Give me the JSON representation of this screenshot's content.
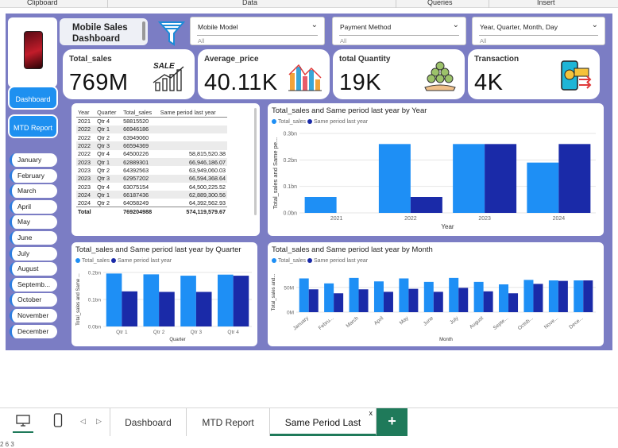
{
  "ribbon": {
    "clipboard": "Clipboard",
    "data": "Data",
    "queries": "Queries",
    "insert": "Insert"
  },
  "title": "Mobile Sales Dashboard",
  "slicers": [
    {
      "label": "Mobile Model",
      "value": "All"
    },
    {
      "label": "Payment Method",
      "value": "All"
    },
    {
      "label": "Year, Quarter, Month, Day",
      "value": "All"
    }
  ],
  "kpis": [
    {
      "title": "Total_sales",
      "value": "769M",
      "icon": "sale-chart-icon"
    },
    {
      "title": "Average_price",
      "value": "40.11K",
      "icon": "bar-chart-icon"
    },
    {
      "title": "total Quantity",
      "value": "19K",
      "icon": "coins-hand-icon"
    },
    {
      "title": "Transaction",
      "value": "4K",
      "icon": "phone-payment-icon"
    }
  ],
  "sale_badge": "SALE",
  "nav": {
    "dashboard": "Dashboard",
    "mtd": "MTD Report"
  },
  "months": [
    "January",
    "February",
    "March",
    "April",
    "May",
    "June",
    "July",
    "August",
    "Septemb...",
    "October",
    "November",
    "December"
  ],
  "table": {
    "headers": [
      "Year",
      "Quarter",
      "Total_sales",
      "Same period last year"
    ],
    "rows": [
      [
        "2021",
        "Qtr 4",
        "58815520",
        ""
      ],
      [
        "2022",
        "Qtr 1",
        "66946186",
        ""
      ],
      [
        "2022",
        "Qtr 2",
        "63949060",
        ""
      ],
      [
        "2022",
        "Qtr 3",
        "66594369",
        ""
      ],
      [
        "2022",
        "Qtr 4",
        "64500226",
        "58,815,520.38"
      ],
      [
        "2023",
        "Qtr 1",
        "62889301",
        "66,946,186.07"
      ],
      [
        "2023",
        "Qtr 2",
        "64392563",
        "63,949,060.03"
      ],
      [
        "2023",
        "Qtr 3",
        "62957202",
        "66,594,368.64"
      ],
      [
        "2023",
        "Qtr 4",
        "63075154",
        "64,500,225.52"
      ],
      [
        "2024",
        "Qtr 1",
        "66187436",
        "62,889,300.56"
      ],
      [
        "2024",
        "Qtr 2",
        "64058249",
        "64,392,562.93"
      ]
    ],
    "total": [
      "Total",
      "",
      "769204988",
      "574,119,579.67"
    ]
  },
  "colors": {
    "current": "#1e8ff5",
    "previous": "#1a2aa8",
    "canvas": "#7b7dc4"
  },
  "chart_data": [
    {
      "type": "bar",
      "title": "Total_sales and Same period last year by Year",
      "legend": [
        "Total_sales",
        "Same period last year"
      ],
      "xlabel": "Year",
      "ylabel": "Total_sales and Same pe...",
      "categories": [
        "2021",
        "2022",
        "2023",
        "2024"
      ],
      "series": [
        {
          "name": "Total_sales",
          "values": [
            0.06,
            0.26,
            0.26,
            0.19
          ]
        },
        {
          "name": "Same period last year",
          "values": [
            0,
            0.06,
            0.26,
            0.26
          ]
        }
      ],
      "yticks": [
        "0.0bn",
        "0.1bn",
        "0.2bn",
        "0.3bn"
      ],
      "ylim": [
        0,
        0.3
      ],
      "units": "bn"
    },
    {
      "type": "bar",
      "title": "Total_sales and Same period last year by Quarter",
      "legend": [
        "Total_sales",
        "Same period last year"
      ],
      "xlabel": "Quarter",
      "ylabel": "Total_sales and Same ...",
      "categories": [
        "Qtr 1",
        "Qtr 2",
        "Qtr 3",
        "Qtr 4"
      ],
      "series": [
        {
          "name": "Total_sales",
          "values": [
            0.196,
            0.193,
            0.188,
            0.192
          ]
        },
        {
          "name": "Same period last year",
          "values": [
            0.13,
            0.128,
            0.128,
            0.188
          ]
        }
      ],
      "yticks": [
        "0.0bn",
        "0.1bn",
        "0.2bn"
      ],
      "ylim": [
        0,
        0.2
      ],
      "units": "bn"
    },
    {
      "type": "bar",
      "title": "Total_sales and Same period last year by Month",
      "legend": [
        "Total_sales",
        "Same period last year"
      ],
      "xlabel": "Month",
      "ylabel": "Total_sales and...",
      "categories": [
        "January",
        "Febru...",
        "March",
        "April",
        "May",
        "June",
        "July",
        "August",
        "Septe...",
        "Octob...",
        "Nove...",
        "Dece..."
      ],
      "series": [
        {
          "name": "Total_sales",
          "values": [
            68,
            58,
            69,
            62,
            68,
            61,
            69,
            61,
            56,
            65,
            64,
            64
          ]
        },
        {
          "name": "Same period last year",
          "values": [
            46,
            38,
            46,
            41,
            47,
            41,
            49,
            42,
            38,
            57,
            63,
            64
          ]
        }
      ],
      "yticks": [
        "0M",
        "50M"
      ],
      "ylim": [
        0,
        80
      ],
      "units": "M"
    }
  ],
  "sheet_tabs": [
    "Dashboard",
    "MTD Report",
    "Same Period Last"
  ],
  "close_x": "x",
  "add_tab": "+",
  "status": "2 6 3"
}
